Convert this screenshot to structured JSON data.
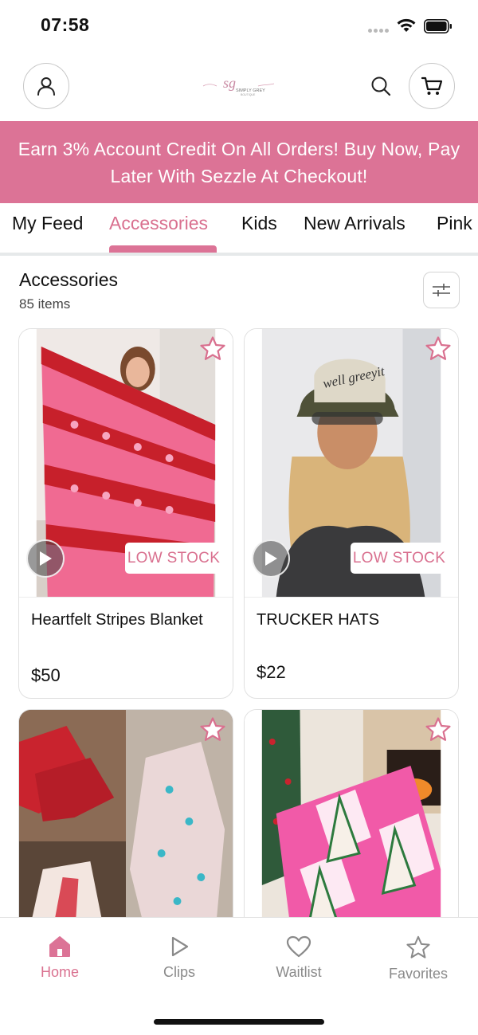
{
  "status_bar": {
    "time": "07:58"
  },
  "header": {
    "logo_initials": "sg",
    "logo_name": "SIMPLY GREY",
    "logo_sub": "BOUTIQUE"
  },
  "promo": {
    "text": "Earn 3% Account Credit On All Orders! Buy Now, Pay Later With Sezzle At Checkout!"
  },
  "tabs": [
    {
      "label": "My Feed",
      "active": false
    },
    {
      "label": "Accessories",
      "active": true
    },
    {
      "label": "Kids",
      "active": false
    },
    {
      "label": "New Arrivals",
      "active": false
    },
    {
      "label": "Pink",
      "active": false
    }
  ],
  "section": {
    "title": "Accessories",
    "count": "85 items"
  },
  "products": [
    {
      "name": "Heartfelt Stripes Blanket",
      "price": "$50",
      "badge": "LOW STOCK",
      "has_video": true,
      "favorited": false
    },
    {
      "name": "TRUCKER HATS",
      "price": "$22",
      "badge": "LOW STOCK",
      "has_video": true,
      "favorited": false
    },
    {
      "favorited": false
    },
    {
      "favorited": false
    }
  ],
  "bottom_nav": [
    {
      "label": "Home",
      "icon": "home-icon",
      "active": true
    },
    {
      "label": "Clips",
      "icon": "play-icon",
      "active": false
    },
    {
      "label": "Waitlist",
      "icon": "heart-icon",
      "active": false
    },
    {
      "label": "Favorites",
      "icon": "star-icon",
      "active": false
    }
  ],
  "colors": {
    "accent": "#dc7396",
    "accent_text": "#d9708f"
  }
}
